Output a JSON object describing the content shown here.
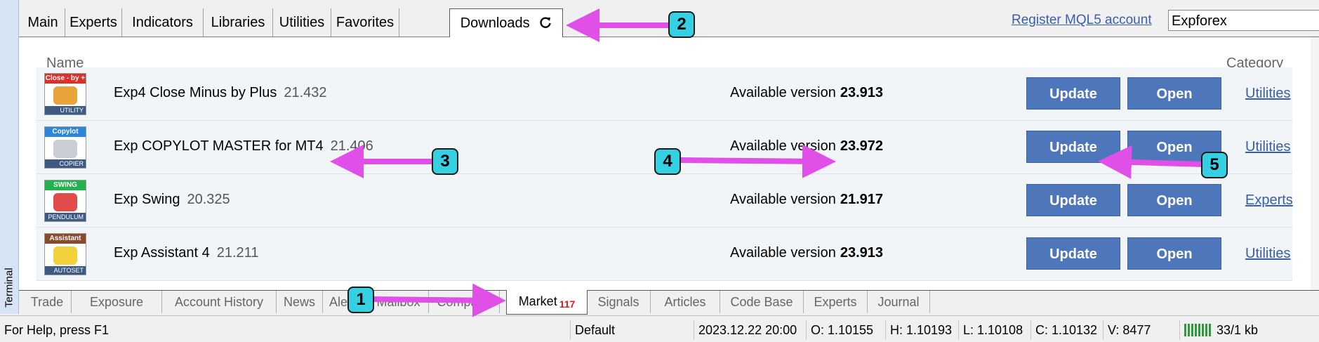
{
  "terminal_label": "Terminal",
  "top_tabs": [
    {
      "label": "Main"
    },
    {
      "label": "Experts"
    },
    {
      "label": "Indicators"
    },
    {
      "label": "Libraries"
    },
    {
      "label": "Utilities"
    },
    {
      "label": "Favorites"
    },
    {
      "label": "Downloads"
    }
  ],
  "register_link": "Register MQL5 account",
  "search_value": "Expforex",
  "columns": {
    "name": "Name",
    "category": "Category"
  },
  "rows": [
    {
      "name": "Exp4 Close Minus by Plus",
      "version": "21.432",
      "available_label": "Available version",
      "available_version": "23.913",
      "update_label": "Update",
      "open_label": "Open",
      "category": "Utilities",
      "thumb_title": "Close - by +",
      "thumb_footer": "UTILITY",
      "thumb_color": "#d9312b"
    },
    {
      "name": "Exp COPYLOT MASTER for MT4",
      "version": "21.406",
      "available_label": "Available version",
      "available_version": "23.972",
      "update_label": "Update",
      "open_label": "Open",
      "category": "Utilities",
      "thumb_title": "Copylot",
      "thumb_footer": "COPIER",
      "thumb_color": "#2b88d9"
    },
    {
      "name": "Exp Swing",
      "version": "20.325",
      "available_label": "Available version",
      "available_version": "21.917",
      "update_label": "Update",
      "open_label": "Open",
      "category": "Experts",
      "thumb_title": "SWING",
      "thumb_footer": "PENDULUM",
      "thumb_color": "#21b24b"
    },
    {
      "name": "Exp Assistant 4",
      "version": "21.211",
      "available_label": "Available version",
      "available_version": "23.913",
      "update_label": "Update",
      "open_label": "Open",
      "category": "Utilities",
      "thumb_title": "Assistant",
      "thumb_footer": "AUTOSET",
      "thumb_color": "#8a4b2c"
    }
  ],
  "bottom_tabs": [
    {
      "label": "Trade"
    },
    {
      "label": "Exposure"
    },
    {
      "label": "Account History"
    },
    {
      "label": "News"
    },
    {
      "label": "Alerts"
    },
    {
      "label": "Mailbox"
    },
    {
      "label": "Company"
    },
    {
      "label": "Market",
      "badge": "117"
    },
    {
      "label": "Signals"
    },
    {
      "label": "Articles"
    },
    {
      "label": "Code Base"
    },
    {
      "label": "Experts"
    },
    {
      "label": "Journal"
    }
  ],
  "status": {
    "help": "For Help, press F1",
    "profile": "Default",
    "datetime": "2023.12.22 20:00",
    "open": "O: 1.10155",
    "high": "H: 1.10193",
    "low": "L: 1.10108",
    "close": "C: 1.10132",
    "volume": "V: 8477",
    "traffic": "33/1 kb"
  },
  "annotations": [
    "1",
    "2",
    "3",
    "4",
    "5"
  ],
  "colors": {
    "accent": "#4e77bb",
    "link": "#3a5ea8",
    "arrow": "#e050e8",
    "badge": "#35d1e3"
  }
}
